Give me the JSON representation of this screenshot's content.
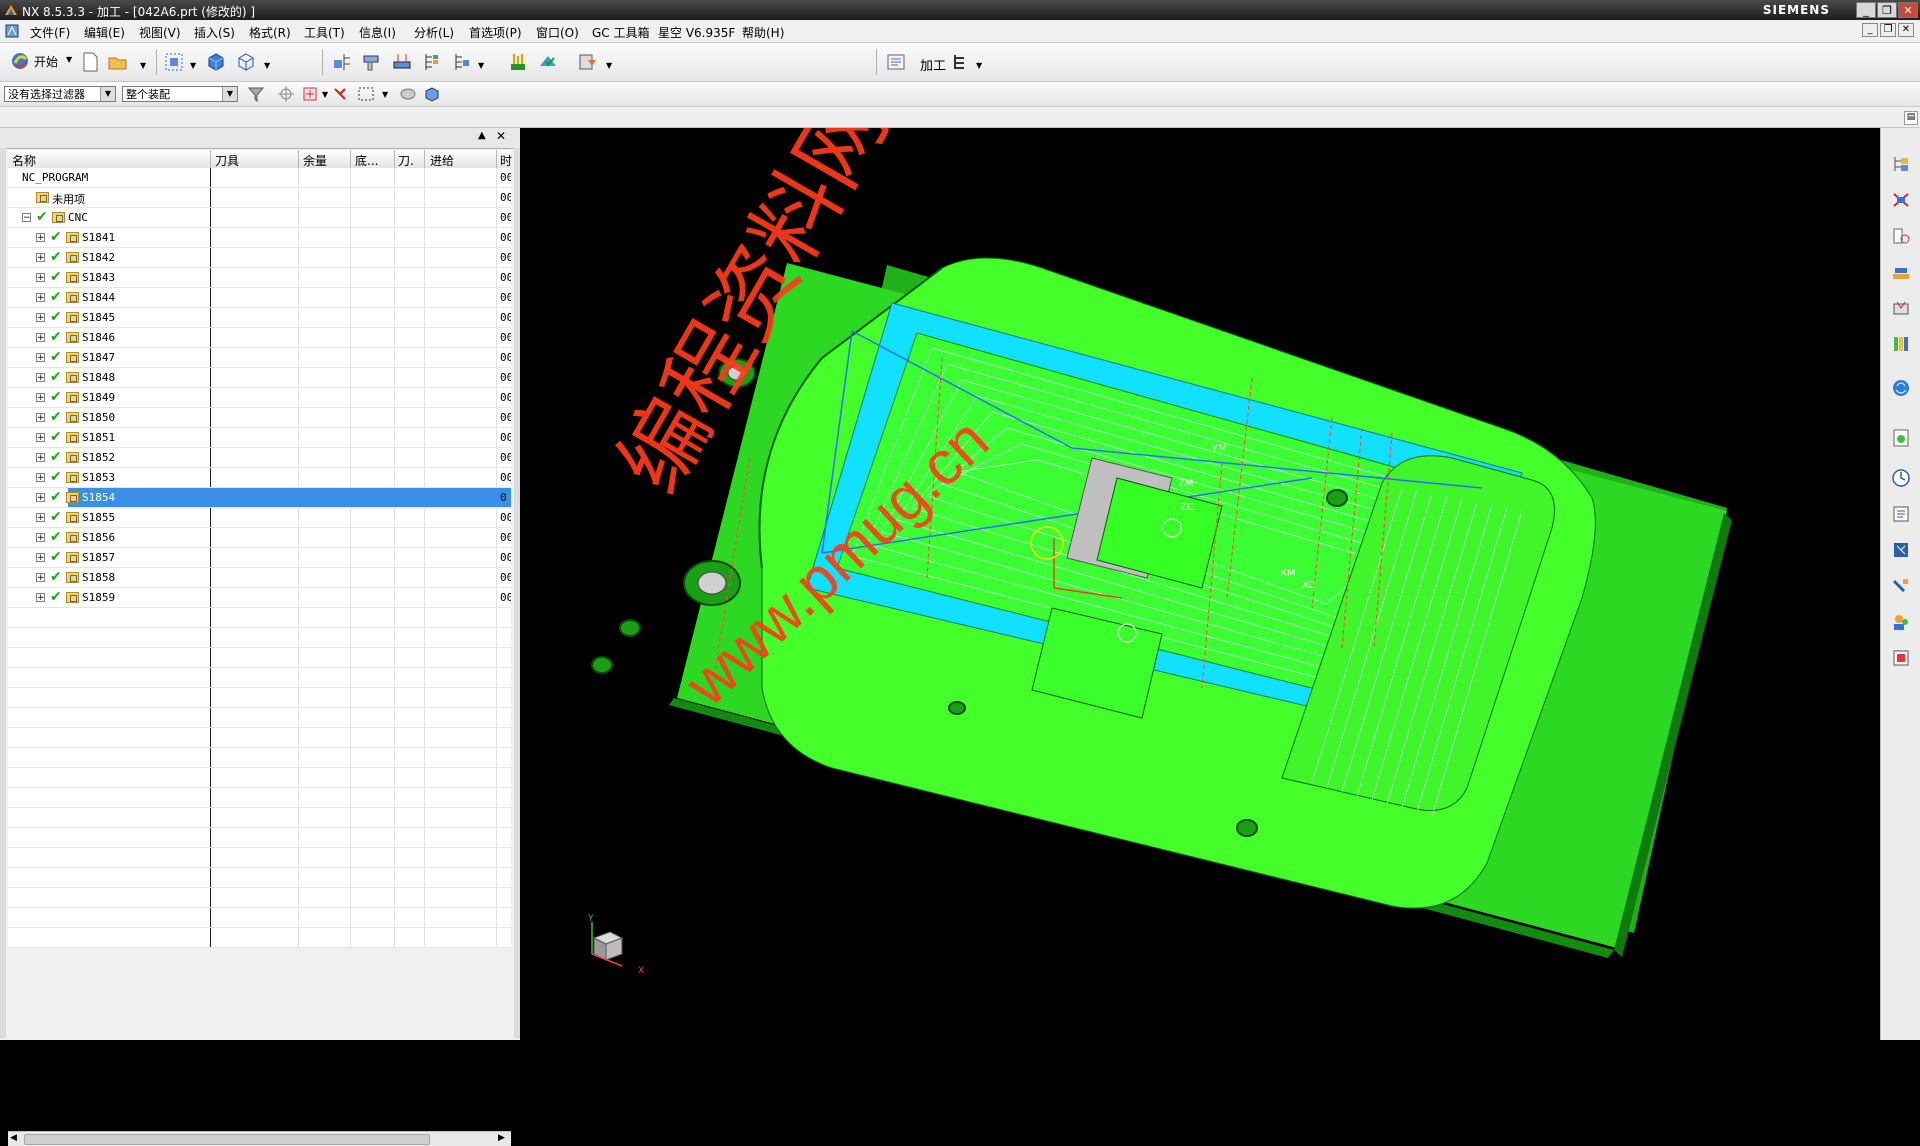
{
  "window": {
    "title": "NX 8.5.3.3 - 加工 - [042A6.prt (修改的) ]",
    "brand": "SIEMENS",
    "minimize": "_",
    "maximize": "❐",
    "close": "✕"
  },
  "menu": {
    "items": [
      "文件(F)",
      "编辑(E)",
      "视图(V)",
      "插入(S)",
      "格式(R)",
      "工具(T)",
      "信息(I)",
      "分析(L)",
      "首选项(P)",
      "窗口(O)",
      "GC 工具箱",
      "星空 V6.935F",
      "帮助(H)"
    ]
  },
  "toolbar": {
    "start_label": "开始",
    "right_labels": [
      "加工"
    ]
  },
  "selection_bar": {
    "filter_value": "没有选择过滤器",
    "scope_value": "整个装配"
  },
  "navigator": {
    "columns": [
      "名称",
      "刀具",
      "余量",
      "底...",
      "刀.",
      "进给",
      "时"
    ],
    "rows": [
      {
        "name": "NC_PROGRAM",
        "level": 0,
        "expander": "",
        "check": false,
        "folder": false,
        "tail": "00"
      },
      {
        "name": "未用项",
        "level": 1,
        "expander": "",
        "check": false,
        "folder": true,
        "tail": "00"
      },
      {
        "name": "CNC",
        "level": 1,
        "expander": "−",
        "check": true,
        "folder": true,
        "tail": "00"
      },
      {
        "name": "S1841",
        "level": 2,
        "expander": "+",
        "check": true,
        "folder": true,
        "tail": "00"
      },
      {
        "name": "S1842",
        "level": 2,
        "expander": "+",
        "check": true,
        "folder": true,
        "tail": "00"
      },
      {
        "name": "S1843",
        "level": 2,
        "expander": "+",
        "check": true,
        "folder": true,
        "tail": "00"
      },
      {
        "name": "S1844",
        "level": 2,
        "expander": "+",
        "check": true,
        "folder": true,
        "tail": "00"
      },
      {
        "name": "S1845",
        "level": 2,
        "expander": "+",
        "check": true,
        "folder": true,
        "tail": "00"
      },
      {
        "name": "S1846",
        "level": 2,
        "expander": "+",
        "check": true,
        "folder": true,
        "tail": "00"
      },
      {
        "name": "S1847",
        "level": 2,
        "expander": "+",
        "check": true,
        "folder": true,
        "tail": "00"
      },
      {
        "name": "S1848",
        "level": 2,
        "expander": "+",
        "check": true,
        "folder": true,
        "tail": "00"
      },
      {
        "name": "S1849",
        "level": 2,
        "expander": "+",
        "check": true,
        "folder": true,
        "tail": "00"
      },
      {
        "name": "S1850",
        "level": 2,
        "expander": "+",
        "check": true,
        "folder": true,
        "tail": "00"
      },
      {
        "name": "S1851",
        "level": 2,
        "expander": "+",
        "check": true,
        "folder": true,
        "tail": "00"
      },
      {
        "name": "S1852",
        "level": 2,
        "expander": "+",
        "check": true,
        "folder": true,
        "tail": "00"
      },
      {
        "name": "S1853",
        "level": 2,
        "expander": "+",
        "check": true,
        "folder": true,
        "tail": "00"
      },
      {
        "name": "S1854",
        "level": 2,
        "expander": "+",
        "check": true,
        "folder": true,
        "tail": "0",
        "selected": true
      },
      {
        "name": "S1855",
        "level": 2,
        "expander": "+",
        "check": true,
        "folder": true,
        "tail": "00"
      },
      {
        "name": "S1856",
        "level": 2,
        "expander": "+",
        "check": true,
        "folder": true,
        "tail": "00"
      },
      {
        "name": "S1857",
        "level": 2,
        "expander": "+",
        "check": true,
        "folder": true,
        "tail": "00"
      },
      {
        "name": "S1858",
        "level": 2,
        "expander": "+",
        "check": true,
        "folder": true,
        "tail": "00"
      },
      {
        "name": "S1859",
        "level": 2,
        "expander": "+",
        "check": true,
        "folder": true,
        "tail": "00"
      }
    ]
  },
  "viewport": {
    "watermark_cn": "编程资料网",
    "watermark_url": "www.pmug.cn",
    "axis_labels": [
      "YM",
      "ZM",
      "ZC",
      "XM",
      "XC"
    ],
    "triad_labels": [
      "Y",
      "X"
    ],
    "colors": {
      "part": "#33ee22",
      "toolpath": "#00e5ff",
      "watermark": "#ff3b1a"
    }
  },
  "icons": [
    "app-icon",
    "start-icon",
    "new-file-icon",
    "open-file-icon",
    "fit-view-icon",
    "shaded-view-icon",
    "wireframe-view-icon",
    "create-program-icon",
    "create-tool-icon",
    "create-geometry-icon",
    "create-method-icon",
    "create-operation-icon",
    "generate-path-icon",
    "verify-path-icon",
    "post-process-icon",
    "filter-icon",
    "snap-icon",
    "select-box-icon",
    "reset-icon",
    "machine-tool-view-icon",
    "geometry-view-icon",
    "program-order-view-icon",
    "method-view-icon",
    "assembly-navigator-icon",
    "part-navigator-icon",
    "operation-navigator-icon",
    "roles-icon",
    "history-icon",
    "palette-icon",
    "web-browser-icon",
    "system-materials-icon",
    "process-icon",
    "reuse-library-icon",
    "hd3d-icon"
  ]
}
